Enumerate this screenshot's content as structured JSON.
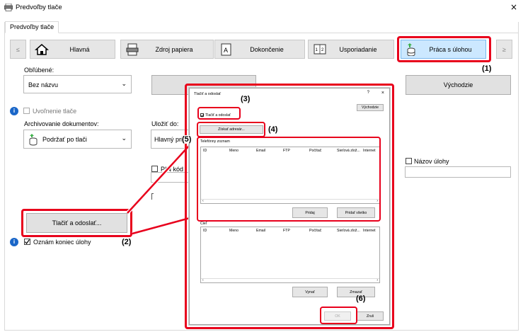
{
  "window": {
    "title": "Predvoľby tlače",
    "close": "×"
  },
  "tabs": [
    "Predvoľby tlače"
  ],
  "nav": {
    "prev": "≤",
    "next": "≥",
    "buttons": [
      "Hlavná",
      "Zdroj papiera",
      "Dokončenie",
      "Usporiadanie",
      "Práca s úlohou"
    ]
  },
  "favorites": {
    "label": "Obľúbené:",
    "value": "Bez názvu",
    "default_button": "Východzie"
  },
  "retention": {
    "label": "Uvoľnenie tlače"
  },
  "archive": {
    "label": "Archivovanie dokumentov:",
    "value": "Podržať po tlači"
  },
  "save_to": {
    "label": "Uložiť do:",
    "value": "Hlavný pri"
  },
  "pin": {
    "label": "PIN kód"
  },
  "job_name": {
    "label": "Názov úlohy"
  },
  "print_send_button": "Tlačiť a odoslať...",
  "notify": {
    "label": "Oznám koniec úlohy"
  },
  "dialog": {
    "title": "Tlačiť a odoslať",
    "help": "?",
    "close": "×",
    "default_button": "Východzie",
    "checkbox_label": "Tlačiť a odoslať",
    "get_address_button": "Získať adresár...",
    "phonebook_label": "Telefónny zoznam",
    "columns": [
      "ID",
      "Meno",
      "Email",
      "FTP",
      "Počítač",
      "Sieťová zlož...",
      "Internet"
    ],
    "add_button": "Pridaj",
    "add_all_button": "Pridať všetko",
    "dest_label": "Cieľ",
    "remove_button": "Vynať",
    "clear_button": "Zmazať",
    "ok_button": "OK",
    "cancel_button": "Zruš"
  },
  "callouts": [
    "(1)",
    "(2)",
    "(3)",
    "(4)",
    "(5)",
    "(6)"
  ],
  "colors": {
    "highlight": "#e8001c",
    "info": "#1a66c8"
  }
}
